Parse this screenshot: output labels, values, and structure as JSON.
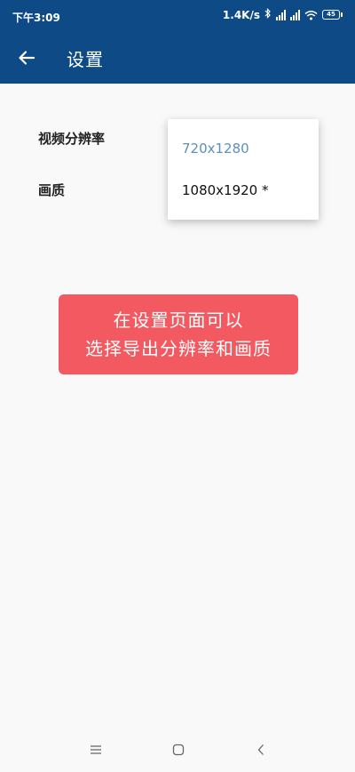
{
  "status_bar": {
    "time": "下午3:09",
    "net_speed": "1.4K/s",
    "battery": "45"
  },
  "app_bar": {
    "title": "设置"
  },
  "settings": {
    "resolution_label": "视频分辨率",
    "quality_label": "画质"
  },
  "dropdown": {
    "options": [
      "720x1280",
      "1080x1920 *"
    ]
  },
  "tip": {
    "line1": "在设置页面可以",
    "line2": "选择导出分辨率和画质"
  },
  "colors": {
    "app_bar": "#0d4a86",
    "tip_banner": "#f25960",
    "selected_option": "#5d8fbf"
  },
  "icons": {
    "back": "arrow-left-icon",
    "bluetooth": "bluetooth-icon",
    "signal": "signal-icon",
    "wifi": "wifi-icon",
    "battery": "battery-icon",
    "nav_menu": "menu-icon",
    "nav_home": "home-icon",
    "nav_back": "chevron-left-icon"
  }
}
